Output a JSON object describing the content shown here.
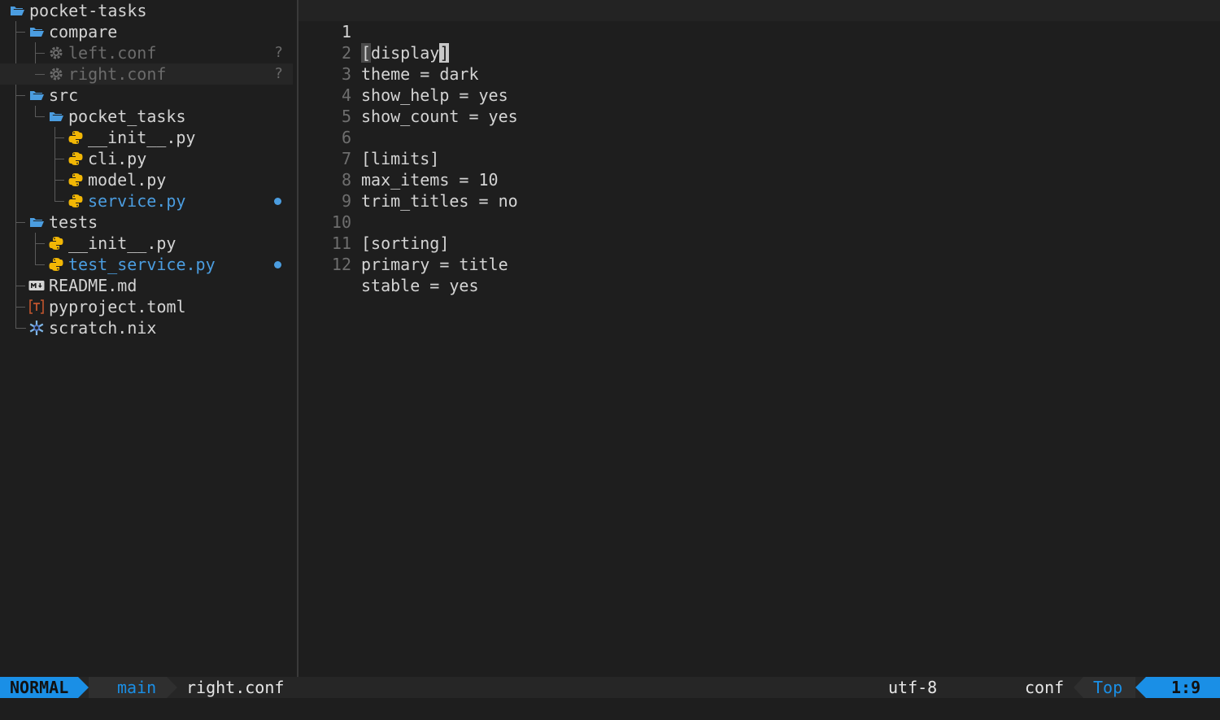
{
  "tree": {
    "root": "pocket-tasks",
    "items": [
      {
        "label": "compare",
        "kind": "folder"
      },
      {
        "label": "left.conf",
        "kind": "gear",
        "status": "?"
      },
      {
        "label": "right.conf",
        "kind": "gear",
        "status": "?"
      },
      {
        "label": "src",
        "kind": "folder"
      },
      {
        "label": "pocket_tasks",
        "kind": "folder"
      },
      {
        "label": "__init__.py",
        "kind": "python"
      },
      {
        "label": "cli.py",
        "kind": "python"
      },
      {
        "label": "model.py",
        "kind": "python"
      },
      {
        "label": "service.py",
        "kind": "python",
        "modified": true
      },
      {
        "label": "tests",
        "kind": "folder"
      },
      {
        "label": "__init__.py",
        "kind": "python"
      },
      {
        "label": "test_service.py",
        "kind": "python",
        "modified": true
      },
      {
        "label": "README.md",
        "kind": "markdown"
      },
      {
        "label": "pyproject.toml",
        "kind": "toml"
      },
      {
        "label": "scratch.nix",
        "kind": "nix"
      }
    ]
  },
  "editor": {
    "lines": [
      {
        "num": "1",
        "text": "[display]"
      },
      {
        "num": "2",
        "text": "theme = dark"
      },
      {
        "num": "3",
        "text": "show_help = yes"
      },
      {
        "num": "4",
        "text": "show_count = yes"
      },
      {
        "num": "5",
        "text": ""
      },
      {
        "num": "6",
        "text": "[limits]"
      },
      {
        "num": "7",
        "text": "max_items = 10"
      },
      {
        "num": "8",
        "text": "trim_titles = no"
      },
      {
        "num": "9",
        "text": ""
      },
      {
        "num": "10",
        "text": "[sorting]"
      },
      {
        "num": "11",
        "text": "primary = title"
      },
      {
        "num": "12",
        "text": "stable = yes"
      }
    ],
    "line1_open": "[",
    "line1_word": "display",
    "line1_close": "]"
  },
  "status": {
    "mode": "NORMAL",
    "branch_icon": "git-branch-icon",
    "branch": "main",
    "file": "right.conf",
    "encoding": "utf-8",
    "os_icon": "linux-tux-icon",
    "filetype_icon": "gear-icon",
    "filetype": "conf",
    "scroll": "Top",
    "position": "1:9"
  },
  "colors": {
    "accent": "#1a8fe6",
    "modified": "#4b9de0",
    "folder": "#4b9de0",
    "python": "#f2b705",
    "toml": "#c2562e"
  }
}
